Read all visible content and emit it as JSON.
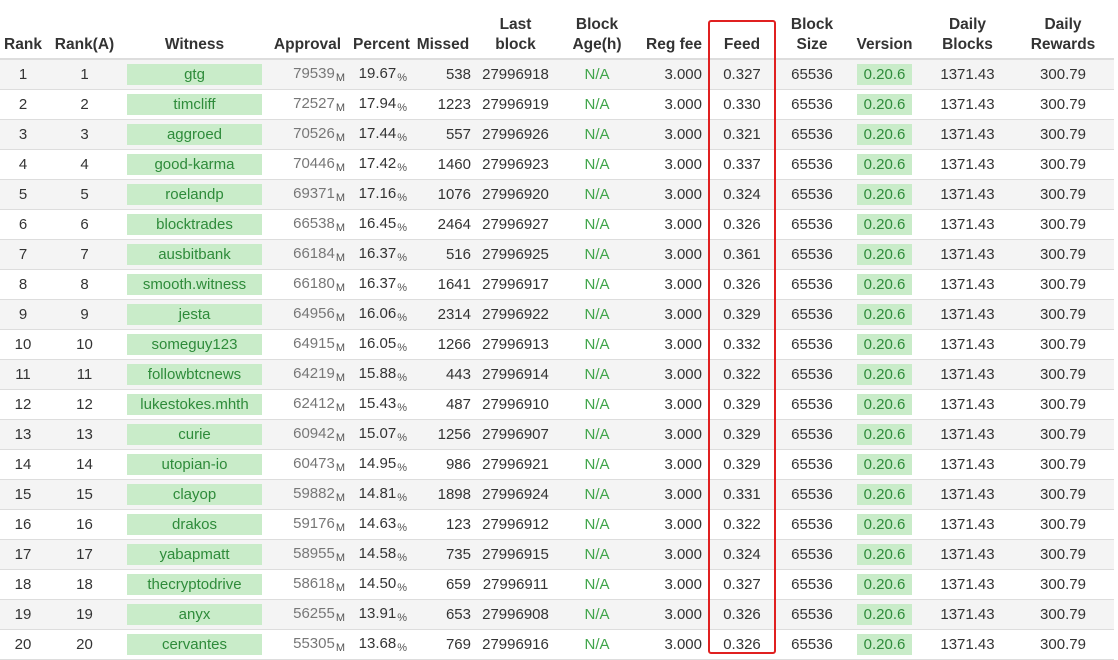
{
  "headers": {
    "rank": "Rank",
    "rank_a": "Rank(A)",
    "witness": "Witness",
    "approval": "Approval",
    "percent": "Percent",
    "missed": "Missed",
    "last_block": "Last block",
    "block_age": "Block Age(h)",
    "reg_fee": "Reg fee",
    "feed": "Feed",
    "block_size": "Block Size",
    "version": "Version",
    "daily_blocks": "Daily Blocks",
    "daily_rewards": "Daily Rewards"
  },
  "units": {
    "approval": "M",
    "percent": "%"
  },
  "colors": {
    "pill_bg": "#c9ecc9",
    "pill_text": "#2e8b3a",
    "highlight": "#e02020"
  },
  "rows": [
    {
      "rank": "1",
      "rank_a": "1",
      "witness": "gtg",
      "approval": "79539",
      "percent": "19.67",
      "missed": "538",
      "last_block": "27996918",
      "block_age": "N/A",
      "reg_fee": "3.000",
      "feed": "0.327",
      "block_size": "65536",
      "version": "0.20.6",
      "daily_blocks": "1371.43",
      "daily_rewards": "300.79"
    },
    {
      "rank": "2",
      "rank_a": "2",
      "witness": "timcliff",
      "approval": "72527",
      "percent": "17.94",
      "missed": "1223",
      "last_block": "27996919",
      "block_age": "N/A",
      "reg_fee": "3.000",
      "feed": "0.330",
      "block_size": "65536",
      "version": "0.20.6",
      "daily_blocks": "1371.43",
      "daily_rewards": "300.79"
    },
    {
      "rank": "3",
      "rank_a": "3",
      "witness": "aggroed",
      "approval": "70526",
      "percent": "17.44",
      "missed": "557",
      "last_block": "27996926",
      "block_age": "N/A",
      "reg_fee": "3.000",
      "feed": "0.321",
      "block_size": "65536",
      "version": "0.20.6",
      "daily_blocks": "1371.43",
      "daily_rewards": "300.79"
    },
    {
      "rank": "4",
      "rank_a": "4",
      "witness": "good-karma",
      "approval": "70446",
      "percent": "17.42",
      "missed": "1460",
      "last_block": "27996923",
      "block_age": "N/A",
      "reg_fee": "3.000",
      "feed": "0.337",
      "block_size": "65536",
      "version": "0.20.6",
      "daily_blocks": "1371.43",
      "daily_rewards": "300.79"
    },
    {
      "rank": "5",
      "rank_a": "5",
      "witness": "roelandp",
      "approval": "69371",
      "percent": "17.16",
      "missed": "1076",
      "last_block": "27996920",
      "block_age": "N/A",
      "reg_fee": "3.000",
      "feed": "0.324",
      "block_size": "65536",
      "version": "0.20.6",
      "daily_blocks": "1371.43",
      "daily_rewards": "300.79"
    },
    {
      "rank": "6",
      "rank_a": "6",
      "witness": "blocktrades",
      "approval": "66538",
      "percent": "16.45",
      "missed": "2464",
      "last_block": "27996927",
      "block_age": "N/A",
      "reg_fee": "3.000",
      "feed": "0.326",
      "block_size": "65536",
      "version": "0.20.6",
      "daily_blocks": "1371.43",
      "daily_rewards": "300.79"
    },
    {
      "rank": "7",
      "rank_a": "7",
      "witness": "ausbitbank",
      "approval": "66184",
      "percent": "16.37",
      "missed": "516",
      "last_block": "27996925",
      "block_age": "N/A",
      "reg_fee": "3.000",
      "feed": "0.361",
      "block_size": "65536",
      "version": "0.20.6",
      "daily_blocks": "1371.43",
      "daily_rewards": "300.79"
    },
    {
      "rank": "8",
      "rank_a": "8",
      "witness": "smooth.witness",
      "approval": "66180",
      "percent": "16.37",
      "missed": "1641",
      "last_block": "27996917",
      "block_age": "N/A",
      "reg_fee": "3.000",
      "feed": "0.326",
      "block_size": "65536",
      "version": "0.20.6",
      "daily_blocks": "1371.43",
      "daily_rewards": "300.79"
    },
    {
      "rank": "9",
      "rank_a": "9",
      "witness": "jesta",
      "approval": "64956",
      "percent": "16.06",
      "missed": "2314",
      "last_block": "27996922",
      "block_age": "N/A",
      "reg_fee": "3.000",
      "feed": "0.329",
      "block_size": "65536",
      "version": "0.20.6",
      "daily_blocks": "1371.43",
      "daily_rewards": "300.79"
    },
    {
      "rank": "10",
      "rank_a": "10",
      "witness": "someguy123",
      "approval": "64915",
      "percent": "16.05",
      "missed": "1266",
      "last_block": "27996913",
      "block_age": "N/A",
      "reg_fee": "3.000",
      "feed": "0.332",
      "block_size": "65536",
      "version": "0.20.6",
      "daily_blocks": "1371.43",
      "daily_rewards": "300.79"
    },
    {
      "rank": "11",
      "rank_a": "11",
      "witness": "followbtcnews",
      "approval": "64219",
      "percent": "15.88",
      "missed": "443",
      "last_block": "27996914",
      "block_age": "N/A",
      "reg_fee": "3.000",
      "feed": "0.322",
      "block_size": "65536",
      "version": "0.20.6",
      "daily_blocks": "1371.43",
      "daily_rewards": "300.79"
    },
    {
      "rank": "12",
      "rank_a": "12",
      "witness": "lukestokes.mhth",
      "approval": "62412",
      "percent": "15.43",
      "missed": "487",
      "last_block": "27996910",
      "block_age": "N/A",
      "reg_fee": "3.000",
      "feed": "0.329",
      "block_size": "65536",
      "version": "0.20.6",
      "daily_blocks": "1371.43",
      "daily_rewards": "300.79"
    },
    {
      "rank": "13",
      "rank_a": "13",
      "witness": "curie",
      "approval": "60942",
      "percent": "15.07",
      "missed": "1256",
      "last_block": "27996907",
      "block_age": "N/A",
      "reg_fee": "3.000",
      "feed": "0.329",
      "block_size": "65536",
      "version": "0.20.6",
      "daily_blocks": "1371.43",
      "daily_rewards": "300.79"
    },
    {
      "rank": "14",
      "rank_a": "14",
      "witness": "utopian-io",
      "approval": "60473",
      "percent": "14.95",
      "missed": "986",
      "last_block": "27996921",
      "block_age": "N/A",
      "reg_fee": "3.000",
      "feed": "0.329",
      "block_size": "65536",
      "version": "0.20.6",
      "daily_blocks": "1371.43",
      "daily_rewards": "300.79"
    },
    {
      "rank": "15",
      "rank_a": "15",
      "witness": "clayop",
      "approval": "59882",
      "percent": "14.81",
      "missed": "1898",
      "last_block": "27996924",
      "block_age": "N/A",
      "reg_fee": "3.000",
      "feed": "0.331",
      "block_size": "65536",
      "version": "0.20.6",
      "daily_blocks": "1371.43",
      "daily_rewards": "300.79"
    },
    {
      "rank": "16",
      "rank_a": "16",
      "witness": "drakos",
      "approval": "59176",
      "percent": "14.63",
      "missed": "123",
      "last_block": "27996912",
      "block_age": "N/A",
      "reg_fee": "3.000",
      "feed": "0.322",
      "block_size": "65536",
      "version": "0.20.6",
      "daily_blocks": "1371.43",
      "daily_rewards": "300.79"
    },
    {
      "rank": "17",
      "rank_a": "17",
      "witness": "yabapmatt",
      "approval": "58955",
      "percent": "14.58",
      "missed": "735",
      "last_block": "27996915",
      "block_age": "N/A",
      "reg_fee": "3.000",
      "feed": "0.324",
      "block_size": "65536",
      "version": "0.20.6",
      "daily_blocks": "1371.43",
      "daily_rewards": "300.79"
    },
    {
      "rank": "18",
      "rank_a": "18",
      "witness": "thecryptodrive",
      "approval": "58618",
      "percent": "14.50",
      "missed": "659",
      "last_block": "27996911",
      "block_age": "N/A",
      "reg_fee": "3.000",
      "feed": "0.327",
      "block_size": "65536",
      "version": "0.20.6",
      "daily_blocks": "1371.43",
      "daily_rewards": "300.79"
    },
    {
      "rank": "19",
      "rank_a": "19",
      "witness": "anyx",
      "approval": "56255",
      "percent": "13.91",
      "missed": "653",
      "last_block": "27996908",
      "block_age": "N/A",
      "reg_fee": "3.000",
      "feed": "0.326",
      "block_size": "65536",
      "version": "0.20.6",
      "daily_blocks": "1371.43",
      "daily_rewards": "300.79"
    },
    {
      "rank": "20",
      "rank_a": "20",
      "witness": "cervantes",
      "approval": "55305",
      "percent": "13.68",
      "missed": "769",
      "last_block": "27996916",
      "block_age": "N/A",
      "reg_fee": "3.000",
      "feed": "0.326",
      "block_size": "65536",
      "version": "0.20.6",
      "daily_blocks": "1371.43",
      "daily_rewards": "300.79"
    }
  ]
}
